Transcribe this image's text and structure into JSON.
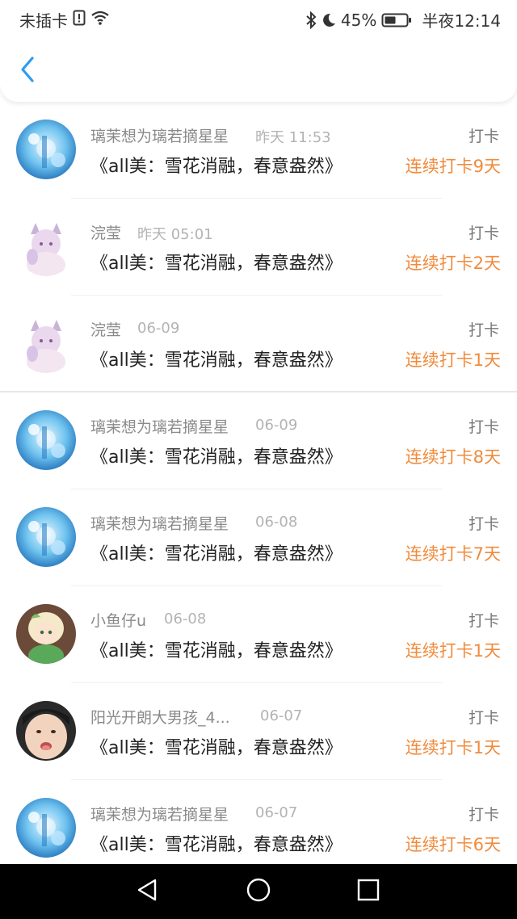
{
  "status_bar": {
    "carrier": "未插卡",
    "icons": [
      "sim-alert-icon",
      "wifi-icon",
      "bluetooth-icon",
      "moon-icon",
      "battery-icon"
    ],
    "battery": "45%",
    "time": "半夜12:14"
  },
  "header": {
    "back_icon": "chevron-left-icon",
    "accent_color": "#2b9cf2"
  },
  "colors": {
    "streak": "#f08b3c",
    "name": "#8a8a8a",
    "time": "#b3b3b3"
  },
  "items": [
    {
      "user": "璃茉想为璃若摘星星",
      "time": "昨天 11:53",
      "title": "《all美：雪花消融，春意盎然》",
      "tag": "打卡",
      "streak": "连续打卡9天",
      "avatar": "blue-anime-avatar"
    },
    {
      "user": "浣莹",
      "time": "昨天 05:01",
      "title": "《all美：雪花消融，春意盎然》",
      "tag": "打卡",
      "streak": "连续打卡2天",
      "avatar": "pink-anime-avatar"
    },
    {
      "user": "浣莹",
      "time": "06-09",
      "title": "《all美：雪花消融，春意盎然》",
      "tag": "打卡",
      "streak": "连续打卡1天",
      "avatar": "pink-anime-avatar"
    },
    {
      "user": "璃茉想为璃若摘星星",
      "time": "06-09",
      "title": "《all美：雪花消融，春意盎然》",
      "tag": "打卡",
      "streak": "连续打卡8天",
      "avatar": "blue-anime-avatar"
    },
    {
      "user": "璃茉想为璃若摘星星",
      "time": "06-08",
      "title": "《all美：雪花消融，春意盎然》",
      "tag": "打卡",
      "streak": "连续打卡7天",
      "avatar": "blue-anime-avatar"
    },
    {
      "user": "小鱼仔u",
      "time": "06-08",
      "title": "《all美：雪花消融，春意盎然》",
      "tag": "打卡",
      "streak": "连续打卡1天",
      "avatar": "green-anime-avatar"
    },
    {
      "user": "阳光开朗大男孩_4...",
      "time": "06-07",
      "title": "《all美：雪花消融，春意盎然》",
      "tag": "打卡",
      "streak": "连续打卡1天",
      "avatar": "child-photo-avatar"
    },
    {
      "user": "璃茉想为璃若摘星星",
      "time": "06-07",
      "title": "《all美：雪花消融，春意盎然》",
      "tag": "打卡",
      "streak": "连续打卡6天",
      "avatar": "blue-anime-avatar"
    }
  ],
  "nav_bar": {
    "icons": [
      "back-triangle-icon",
      "home-circle-icon",
      "recents-square-icon"
    ]
  }
}
